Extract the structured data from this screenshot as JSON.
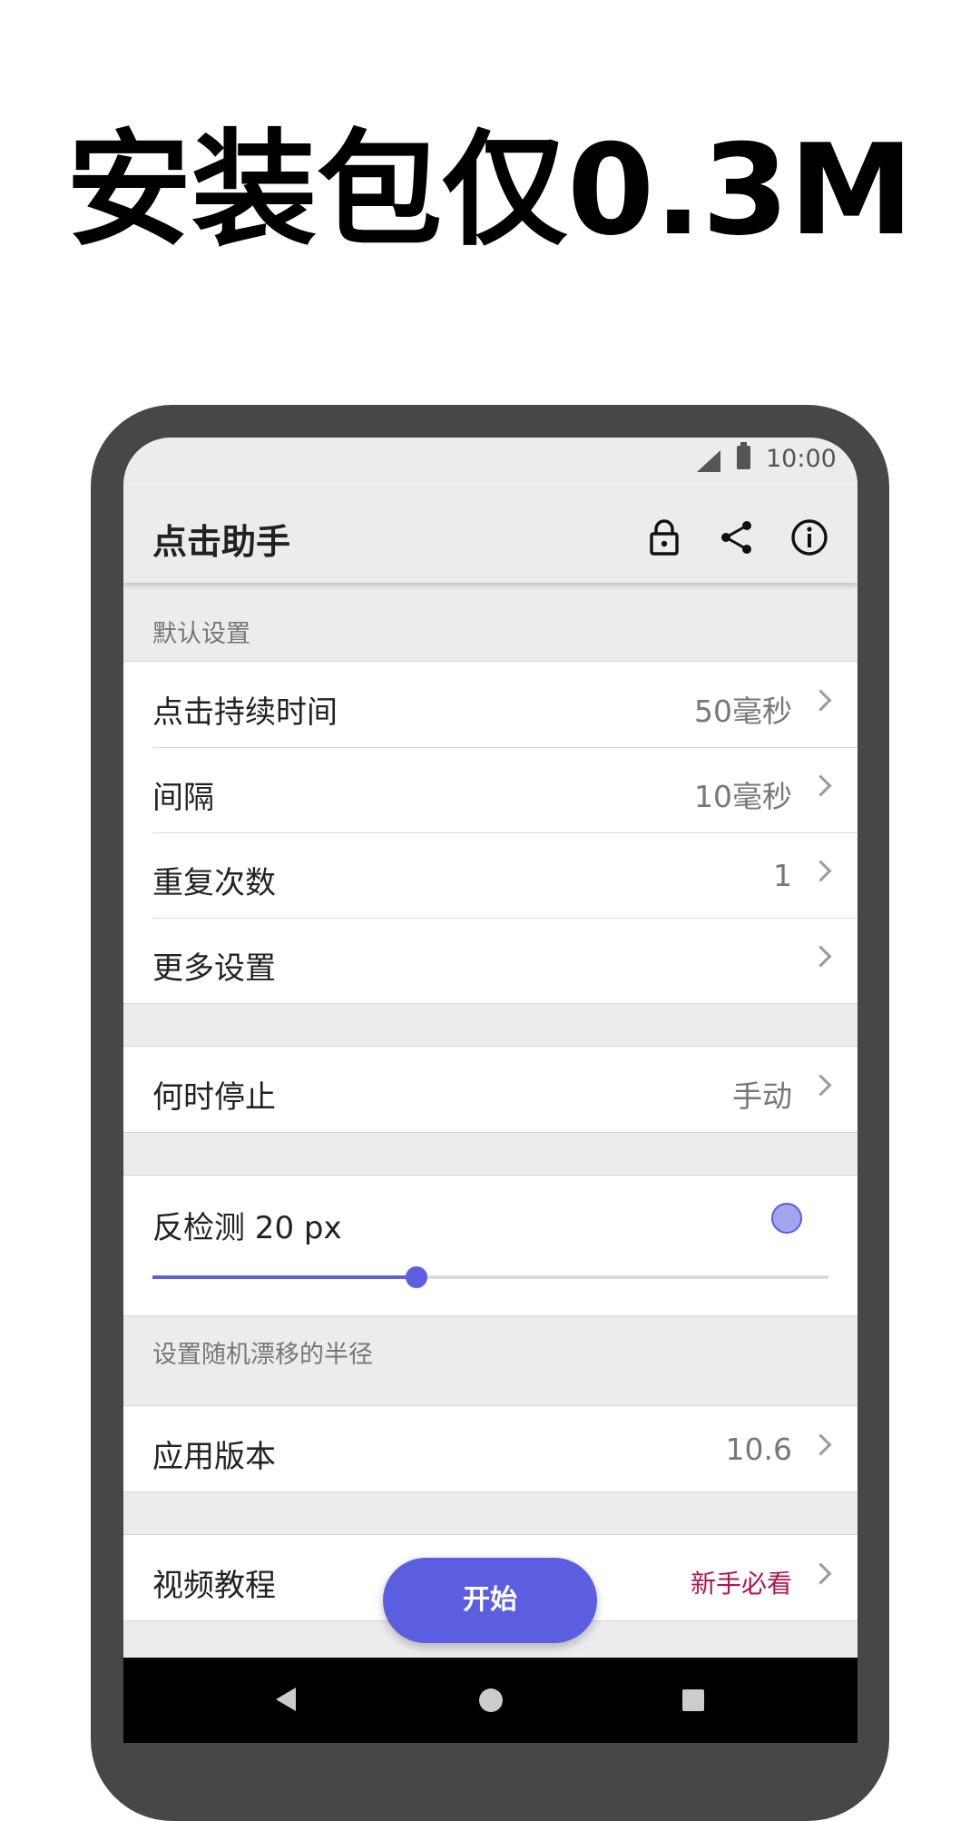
{
  "headline": "安装包仅0.3M",
  "status_bar": {
    "time": "10:00"
  },
  "app_bar": {
    "title": "点击助手",
    "icons": [
      "lock-icon",
      "share-icon",
      "info-icon"
    ]
  },
  "default_section": {
    "header": "默认设置",
    "rows": [
      {
        "label": "点击持续时间",
        "value": "50毫秒"
      },
      {
        "label": "间隔",
        "value": "10毫秒"
      },
      {
        "label": "重复次数",
        "value": "1"
      },
      {
        "label": "更多设置",
        "value": ""
      }
    ]
  },
  "stop_row": {
    "label": "何时停止",
    "value": "手动"
  },
  "anti_detect": {
    "label": "反检测 20 px",
    "level": 0.39,
    "hint": "设置随机漂移的半径",
    "accent_color": "#5b5ee0"
  },
  "version_row": {
    "label": "应用版本",
    "value": "10.6"
  },
  "tutorial_row": {
    "label": "视频教程",
    "value": "新手必看",
    "value_color": "#b0174f"
  },
  "fab": {
    "label": "开始"
  }
}
